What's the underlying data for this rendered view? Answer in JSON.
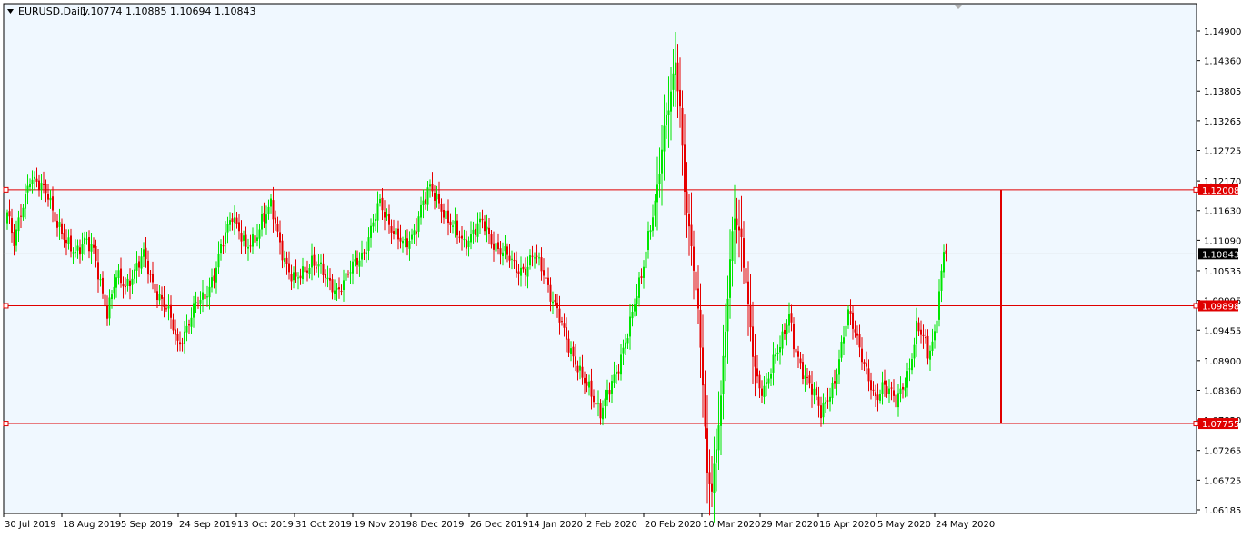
{
  "header": {
    "dropdown_icon": "triangle-down-icon",
    "symbol": "EURUSD,Daily",
    "ohlc": "1.10774 1.10885 1.10694 1.10843"
  },
  "colors": {
    "background": "#f0f8ff",
    "frame": "#000000",
    "bull": "#00e600",
    "bear": "#e60000",
    "level_line": "#e00000",
    "price_line": "#c0c0c0"
  },
  "chart_data": {
    "type": "candlestick",
    "symbol": "EURUSD",
    "timeframe": "Daily",
    "y_ticks": [
      "1.14900",
      "1.14360",
      "1.13805",
      "1.13265",
      "1.12725",
      "1.12170",
      "1.11630",
      "1.11090",
      "1.10535",
      "1.09995",
      "1.09455",
      "1.08900",
      "1.08360",
      "1.07820",
      "1.07265",
      "1.06725",
      "1.06185"
    ],
    "ylim": [
      1.06185,
      1.149
    ],
    "x_ticks": [
      "30 Jul 2019",
      "18 Aug 2019",
      "5 Sep 2019",
      "24 Sep 2019",
      "13 Oct 2019",
      "31 Oct 2019",
      "19 Nov 2019",
      "8 Dec 2019",
      "26 Dec 2019",
      "14 Jan 2020",
      "2 Feb 2020",
      "20 Feb 2020",
      "10 Mar 2020",
      "29 Mar 2020",
      "16 Apr 2020",
      "5 May 2020",
      "24 May 2020"
    ],
    "horizontal_levels": [
      {
        "price": 1.12008,
        "label": "1.12008"
      },
      {
        "price": 1.09898,
        "label": "1.09898"
      },
      {
        "price": 1.07755,
        "label": "1.07755"
      }
    ],
    "current_price": {
      "price": 1.10843,
      "label": "1.10843"
    },
    "vertical_line": {
      "from": 1.12008,
      "to": 1.07755
    },
    "close_path": [
      [
        0,
        1.116
      ],
      [
        3,
        1.11
      ],
      [
        6,
        1.116
      ],
      [
        10,
        1.1225
      ],
      [
        14,
        1.1205
      ],
      [
        18,
        1.1195
      ],
      [
        22,
        1.114
      ],
      [
        26,
        1.11
      ],
      [
        30,
        1.109
      ],
      [
        34,
        1.111
      ],
      [
        38,
        1.1085
      ],
      [
        42,
        1.1015
      ],
      [
        44,
        1.098
      ],
      [
        48,
        1.104
      ],
      [
        52,
        1.1025
      ],
      [
        56,
        1.1055
      ],
      [
        60,
        1.108
      ],
      [
        64,
        1.103
      ],
      [
        66,
        1.1015
      ],
      [
        70,
        1.0985
      ],
      [
        73,
        1.095
      ],
      [
        75,
        1.092
      ],
      [
        79,
        1.095
      ],
      [
        83,
        1.099
      ],
      [
        87,
        1.101
      ],
      [
        91,
        1.1045
      ],
      [
        95,
        1.1105
      ],
      [
        99,
        1.116
      ],
      [
        102,
        1.113
      ],
      [
        105,
        1.109
      ],
      [
        109,
        1.111
      ],
      [
        112,
        1.115
      ],
      [
        116,
        1.117
      ],
      [
        120,
        1.11
      ],
      [
        124,
        1.1055
      ],
      [
        127,
        1.1035
      ],
      [
        131,
        1.105
      ],
      [
        134,
        1.1075
      ],
      [
        137,
        1.1065
      ],
      [
        141,
        1.103
      ],
      [
        145,
        1.102
      ],
      [
        149,
        1.104
      ],
      [
        153,
        1.1065
      ],
      [
        157,
        1.109
      ],
      [
        161,
        1.114
      ],
      [
        164,
        1.1175
      ],
      [
        167,
        1.115
      ],
      [
        171,
        1.112
      ],
      [
        175,
        1.1095
      ],
      [
        179,
        1.1125
      ],
      [
        182,
        1.117
      ],
      [
        186,
        1.12
      ],
      [
        190,
        1.118
      ],
      [
        194,
        1.1145
      ],
      [
        198,
        1.112
      ],
      [
        201,
        1.1105
      ],
      [
        205,
        1.1125
      ],
      [
        209,
        1.114
      ],
      [
        213,
        1.111
      ],
      [
        217,
        1.109
      ],
      [
        221,
        1.1075
      ],
      [
        224,
        1.106
      ],
      [
        228,
        1.1055
      ],
      [
        232,
        1.108
      ],
      [
        236,
        1.1055
      ],
      [
        239,
        1.101
      ],
      [
        243,
        1.0965
      ],
      [
        246,
        1.093
      ],
      [
        250,
        1.089
      ],
      [
        253,
        1.0855
      ],
      [
        257,
        1.083
      ],
      [
        261,
        1.08
      ],
      [
        264,
        1.0825
      ],
      [
        268,
        1.0865
      ],
      [
        271,
        1.0915
      ],
      [
        275,
        1.0975
      ],
      [
        279,
        1.104
      ],
      [
        282,
        1.112
      ],
      [
        286,
        1.12
      ],
      [
        289,
        1.1305
      ],
      [
        292,
        1.138
      ],
      [
        294,
        1.144
      ],
      [
        296,
        1.135
      ],
      [
        298,
        1.12
      ],
      [
        300,
        1.112
      ],
      [
        302,
        1.106
      ],
      [
        304,
        1.098
      ],
      [
        306,
        1.086
      ],
      [
        308,
        1.068
      ],
      [
        310,
        1.0655
      ],
      [
        312,
        1.072
      ],
      [
        314,
        1.083
      ],
      [
        316,
        1.095
      ],
      [
        318,
        1.108
      ],
      [
        320,
        1.1155
      ],
      [
        323,
        1.11
      ],
      [
        325,
        1.103
      ],
      [
        327,
        1.095
      ],
      [
        329,
        1.088
      ],
      [
        331,
        1.084
      ],
      [
        333,
        1.083
      ],
      [
        335,
        1.0855
      ],
      [
        338,
        1.0905
      ],
      [
        341,
        1.0935
      ],
      [
        344,
        1.097
      ],
      [
        346,
        1.0915
      ],
      [
        349,
        1.088
      ],
      [
        352,
        1.086
      ],
      [
        355,
        1.083
      ],
      [
        358,
        1.079
      ],
      [
        361,
        1.0825
      ],
      [
        364,
        1.0855
      ],
      [
        367,
        1.091
      ],
      [
        370,
        1.0975
      ],
      [
        373,
        1.095
      ],
      [
        376,
        1.09
      ],
      [
        379,
        1.085
      ],
      [
        382,
        1.0815
      ],
      [
        385,
        1.085
      ],
      [
        388,
        1.084
      ],
      [
        391,
        1.081
      ],
      [
        394,
        1.084
      ],
      [
        397,
        1.088
      ],
      [
        400,
        1.095
      ],
      [
        403,
        1.093
      ],
      [
        405,
        1.09
      ],
      [
        408,
        1.094
      ],
      [
        410,
        1.102
      ],
      [
        412,
        1.108
      ],
      [
        413,
        1.1084
      ]
    ]
  }
}
